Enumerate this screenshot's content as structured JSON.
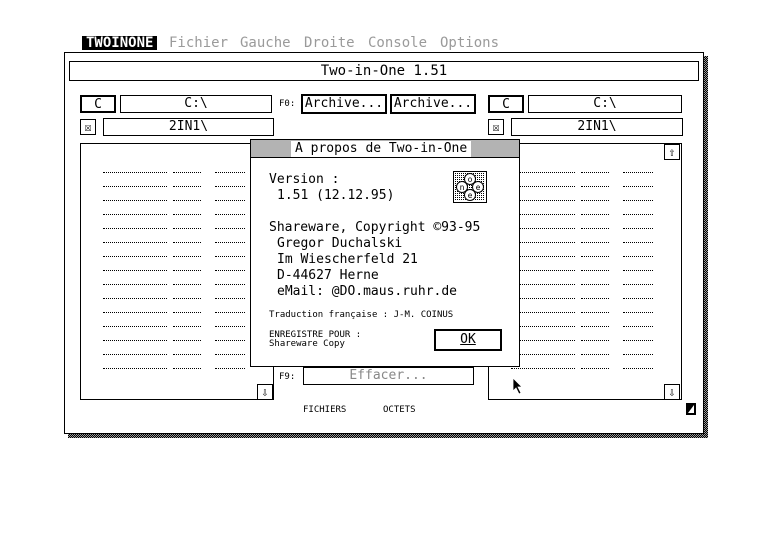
{
  "menu": {
    "app": "TWOINONE",
    "items": [
      "Fichier",
      "Gauche",
      "Droite",
      "Console",
      "Options"
    ]
  },
  "window": {
    "title": "Two-in-One 1.51"
  },
  "left_panel": {
    "drive": "C",
    "path": "C:\\",
    "close_glyph": "☒",
    "folder": "2IN1\\"
  },
  "right_panel": {
    "drive": "C",
    "path": "C:\\",
    "close_glyph": "☒",
    "folder": "2IN1\\"
  },
  "center": {
    "f0_label": "F0:",
    "archive_left": "Archive...",
    "archive_right": "Archive...",
    "f9_label": "F9:",
    "delete_button": "Effacer..."
  },
  "status": {
    "files_label": "FICHIERS",
    "bytes_label": "OCTETS"
  },
  "scroll": {
    "up_glyph": "⇧",
    "down_glyph": "⇩"
  },
  "dialog": {
    "title": "A propos de Two-in-One",
    "version_label": "Version :",
    "version_value": "1.51 (12.12.95)",
    "copyright": "Shareware, Copyright ©93-95",
    "author": "Gregor Duchalski",
    "street": "Im Wiescherfeld 21",
    "city": "D-44627 Herne",
    "email": "eMail: @DO.maus.ruhr.de",
    "translation": "Traduction française : J-M. COINUS",
    "registered_label": "ENREGISTRE POUR :",
    "registered_value": "Shareware Copy",
    "ok": "OK",
    "logo_letters": [
      "o",
      "n",
      "e",
      "e"
    ]
  }
}
